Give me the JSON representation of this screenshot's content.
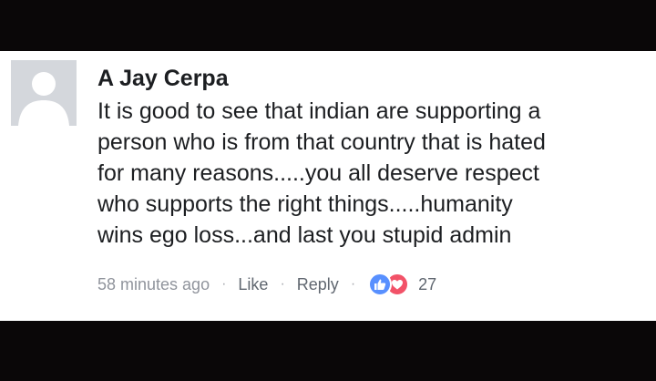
{
  "comment": {
    "author": "A Jay Cerpa",
    "lines": [
      "It is good to see that indian are supporting a",
      "person who is from that country that is hated",
      "for many reasons.....you all deserve respect",
      "who supports the right things.....humanity",
      "wins ego loss...and last you stupid admin"
    ],
    "timestamp": "58 minutes ago",
    "separator": "·",
    "like_label": "Like",
    "reply_label": "Reply",
    "reactions": {
      "icons": [
        "like-icon",
        "love-icon"
      ],
      "count": "27",
      "colors": {
        "like": "#5890ff",
        "love": "#f25268"
      }
    }
  },
  "colors": {
    "frame": "#0a0708",
    "card": "#ffffff",
    "text": "#1c1e21",
    "meta": "#90949c"
  }
}
